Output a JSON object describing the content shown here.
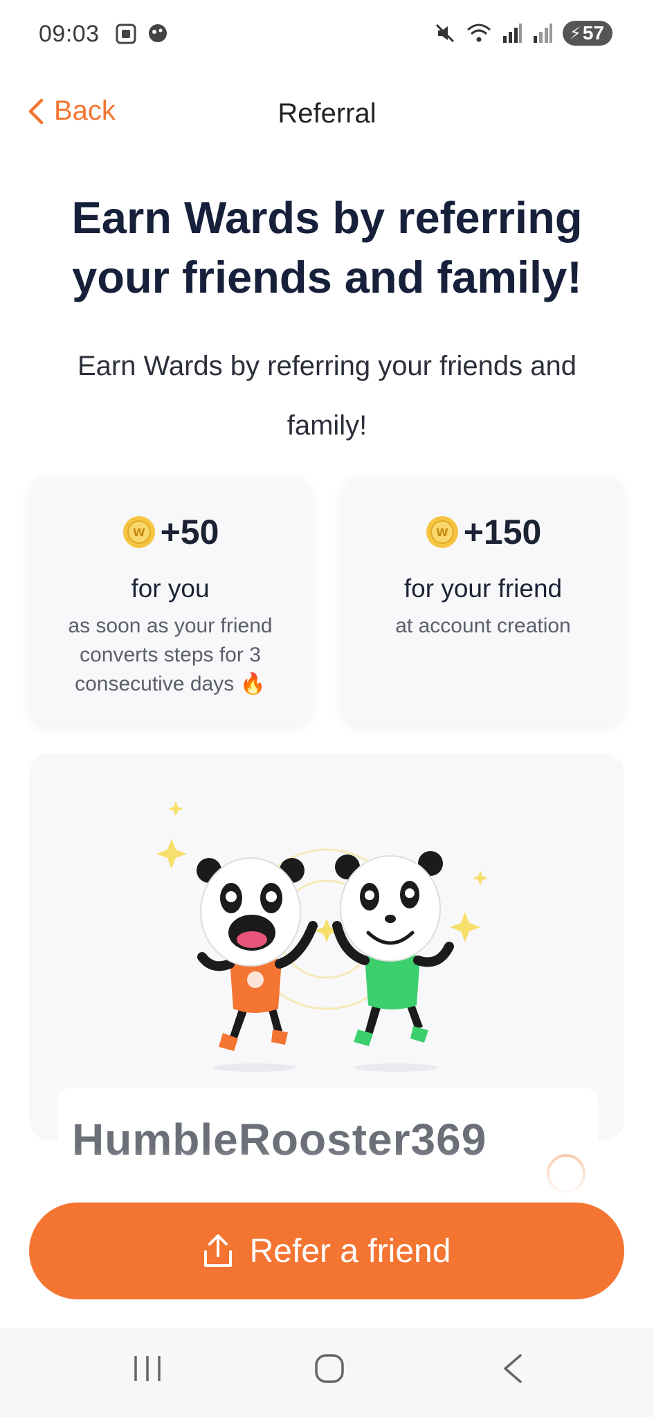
{
  "status_bar": {
    "time": "09:03",
    "battery": "57",
    "left_icons": [
      "screenshot-icon",
      "notification-bubble-icon"
    ],
    "right_icons": [
      "mute-icon",
      "wifi-icon",
      "signal-icon",
      "signal-icon",
      "battery-icon"
    ]
  },
  "header": {
    "back_label": "Back",
    "title": "Referral"
  },
  "hero": {
    "headline": "Earn Wards by referring your friends and family!",
    "subline": "Earn Wards by referring your friends and family!"
  },
  "rewards": [
    {
      "amount": "+50",
      "title": "for you",
      "description": "as soon as your friend converts steps for 3 consecutive days 🔥"
    },
    {
      "amount": "+150",
      "title": "for your friend",
      "description": "at account creation"
    }
  ],
  "referral": {
    "username": "HumbleRooster369"
  },
  "cta": {
    "label": "Refer a friend"
  },
  "colors": {
    "accent": "#f47532",
    "heading": "#16203a",
    "card_bg": "#f8f8fa",
    "coin": "#f5c542",
    "panda_shirt_left": "#f47532",
    "panda_shirt_right": "#3ccf6e"
  }
}
